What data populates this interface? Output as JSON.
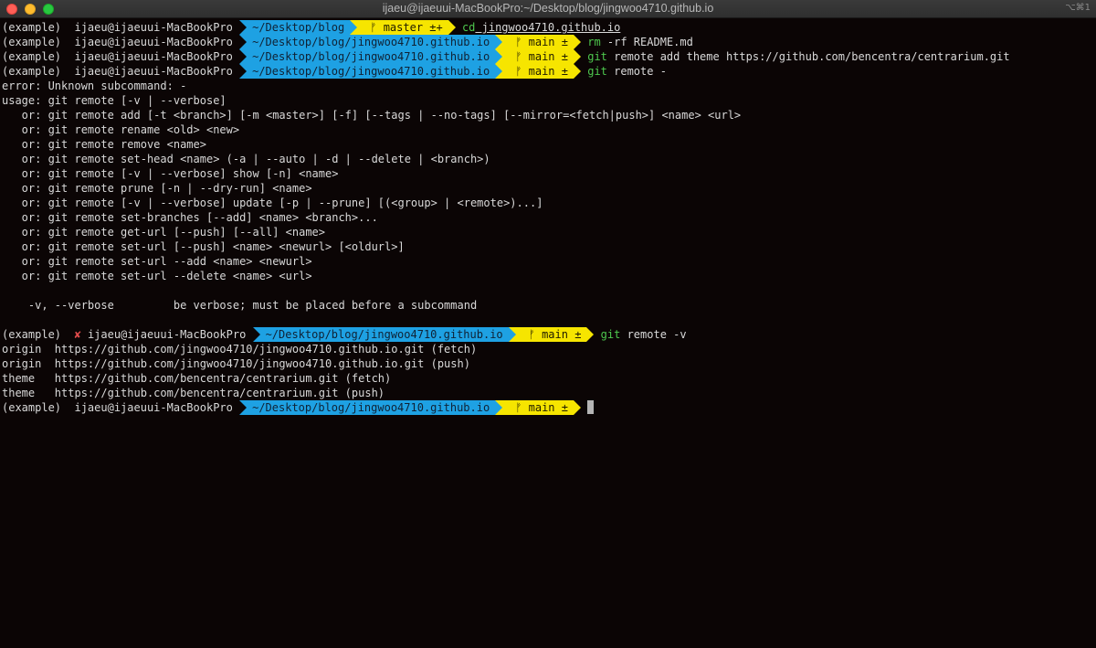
{
  "window": {
    "title": "ijaeu@ijaeuui-MacBookPro:~/Desktop/blog/jingwoo4710.github.io",
    "shortcut": "⌥⌘1"
  },
  "lines": [
    {
      "kind": "prompt",
      "env": "(example)",
      "user": "  ijaeu@ijaeuui-MacBookPro ",
      "dir": "~/Desktop/blog",
      "branch": "ᚠ master ±+",
      "cmd": "cd",
      "args": " jingwoo4710.github.io"
    },
    {
      "kind": "prompt",
      "env": "(example)",
      "user": "  ijaeu@ijaeuui-MacBookPro ",
      "dir": "~/Desktop/blog/jingwoo4710.github.io",
      "branch": "ᚠ main ±",
      "cmd": "rm",
      "args": " -rf README.md"
    },
    {
      "kind": "prompt",
      "env": "(example)",
      "user": "  ijaeu@ijaeuui-MacBookPro ",
      "dir": "~/Desktop/blog/jingwoo4710.github.io",
      "branch": "ᚠ main ±",
      "cmd": "git",
      "args": " remote add theme https://github.com/bencentra/centrarium.git"
    },
    {
      "kind": "prompt",
      "env": "(example)",
      "user": "  ijaeu@ijaeuui-MacBookPro ",
      "dir": "~/Desktop/blog/jingwoo4710.github.io",
      "branch": "ᚠ main ±",
      "cmd": "git",
      "args": " remote -"
    },
    {
      "kind": "text",
      "text": "error: Unknown subcommand: -"
    },
    {
      "kind": "text",
      "text": "usage: git remote [-v | --verbose]"
    },
    {
      "kind": "text",
      "text": "   or: git remote add [-t <branch>] [-m <master>] [-f] [--tags | --no-tags] [--mirror=<fetch|push>] <name> <url>"
    },
    {
      "kind": "text",
      "text": "   or: git remote rename <old> <new>"
    },
    {
      "kind": "text",
      "text": "   or: git remote remove <name>"
    },
    {
      "kind": "text",
      "text": "   or: git remote set-head <name> (-a | --auto | -d | --delete | <branch>)"
    },
    {
      "kind": "text",
      "text": "   or: git remote [-v | --verbose] show [-n] <name>"
    },
    {
      "kind": "text",
      "text": "   or: git remote prune [-n | --dry-run] <name>"
    },
    {
      "kind": "text",
      "text": "   or: git remote [-v | --verbose] update [-p | --prune] [(<group> | <remote>)...]"
    },
    {
      "kind": "text",
      "text": "   or: git remote set-branches [--add] <name> <branch>..."
    },
    {
      "kind": "text",
      "text": "   or: git remote get-url [--push] [--all] <name>"
    },
    {
      "kind": "text",
      "text": "   or: git remote set-url [--push] <name> <newurl> [<oldurl>]"
    },
    {
      "kind": "text",
      "text": "   or: git remote set-url --add <name> <newurl>"
    },
    {
      "kind": "text",
      "text": "   or: git remote set-url --delete <name> <url>"
    },
    {
      "kind": "text",
      "text": ""
    },
    {
      "kind": "text",
      "text": "    -v, --verbose         be verbose; must be placed before a subcommand"
    },
    {
      "kind": "text",
      "text": ""
    },
    {
      "kind": "prompt-error",
      "env": "(example)",
      "cross": "  ✘ ",
      "user": "ijaeu@ijaeuui-MacBookPro ",
      "dir": "~/Desktop/blog/jingwoo4710.github.io",
      "branch": "ᚠ main ±",
      "cmd": "git",
      "args": " remote -v"
    },
    {
      "kind": "text",
      "text": "origin  https://github.com/jingwoo4710/jingwoo4710.github.io.git (fetch)"
    },
    {
      "kind": "text",
      "text": "origin  https://github.com/jingwoo4710/jingwoo4710.github.io.git (push)"
    },
    {
      "kind": "text",
      "text": "theme   https://github.com/bencentra/centrarium.git (fetch)"
    },
    {
      "kind": "text",
      "text": "theme   https://github.com/bencentra/centrarium.git (push)"
    },
    {
      "kind": "prompt-cursor",
      "env": "(example)",
      "user": "  ijaeu@ijaeuui-MacBookPro ",
      "dir": "~/Desktop/blog/jingwoo4710.github.io",
      "branch": "ᚠ main ±"
    }
  ],
  "colors": {
    "background": "#0b0505",
    "dir_segment": "#1ea1e3",
    "git_segment": "#f6e500",
    "command": "#4ec84e",
    "error_cross": "#e04b4b"
  }
}
